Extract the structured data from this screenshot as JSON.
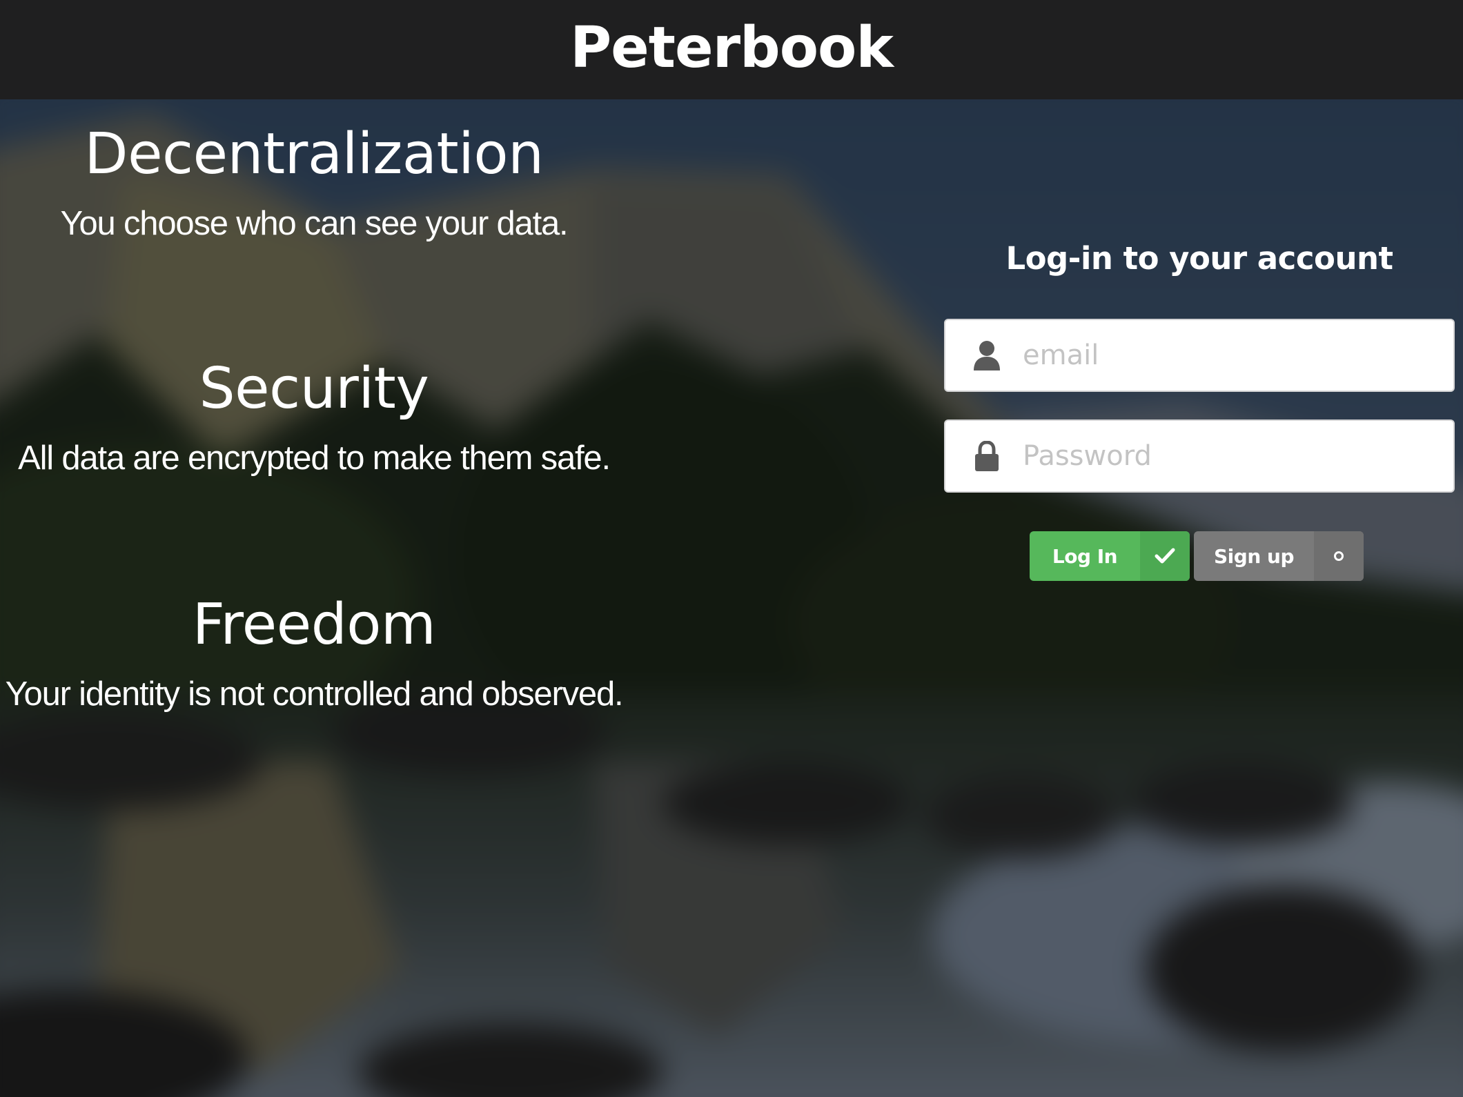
{
  "header": {
    "brand": "Peterbook"
  },
  "features": [
    {
      "title": "Decentralization",
      "text": "You choose who can see your data."
    },
    {
      "title": "Security",
      "text": "All data are encrypted to make them safe."
    },
    {
      "title": "Freedom",
      "text": "Your identity is not controlled and observed."
    }
  ],
  "login": {
    "title": "Log-in to your account",
    "email_placeholder": "email",
    "password_placeholder": "Password",
    "login_label": "Log In",
    "signup_label": "Sign up",
    "email_icon": "user-icon",
    "password_icon": "lock-icon",
    "login_icon": "checkmark-icon",
    "signup_icon": "circle-icon"
  },
  "colors": {
    "header_bg": "#1f1f20",
    "login_button": "#56b85b",
    "signup_button": "#7a7a7a"
  }
}
